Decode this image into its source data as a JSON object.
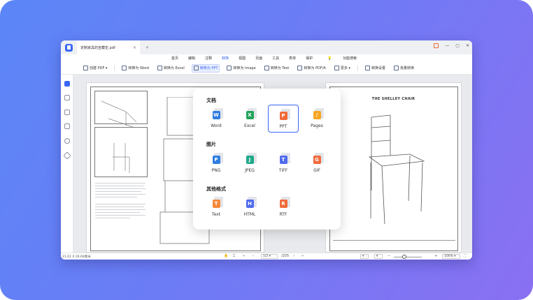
{
  "titlebar": {
    "doc_tab_title": "定制家具的宣藏史.pdf",
    "tab_close": "×",
    "tab_add": "+",
    "minimize": "—",
    "maximize": "▢",
    "close": "✕"
  },
  "menu": {
    "items": [
      "首页",
      "编辑",
      "注释",
      "转换",
      "视图",
      "页面",
      "工具",
      "表单",
      "保护"
    ],
    "active_index": 3,
    "search_placeholder": "功能搜索"
  },
  "toolbar": {
    "create_pdf": "创建 PDF",
    "to_word": "转换为 Word",
    "to_excel": "转换为 Excel",
    "to_ppt": "转换为 PPT",
    "to_image": "转换为 Image",
    "to_text": "转换为 Text",
    "to_pdfa": "转换为 PDF/A",
    "more": "更多",
    "convert_settings": "转换设置",
    "batch_convert": "批量转换"
  },
  "document": {
    "right_page_title": "THE SHELLEY CHAIR"
  },
  "popup": {
    "sections": [
      {
        "title": "文档",
        "items": [
          {
            "label": "Word",
            "letter": "W",
            "color": "#2f7de1"
          },
          {
            "label": "Excel",
            "letter": "X",
            "color": "#22a35a"
          },
          {
            "label": "PPT",
            "letter": "P",
            "color": "#f06a3a"
          },
          {
            "label": "Pages",
            "letter": "∕",
            "color": "#f5a623"
          }
        ]
      },
      {
        "title": "图片",
        "items": [
          {
            "label": "PNG",
            "letter": "P",
            "color": "#2f7de1"
          },
          {
            "label": "JPEG",
            "letter": "J",
            "color": "#20a88a"
          },
          {
            "label": "TIFF",
            "letter": "T",
            "color": "#4f6bee"
          },
          {
            "label": "GIF",
            "letter": "G",
            "color": "#f06a3a"
          }
        ]
      },
      {
        "title": "其他格式",
        "items": [
          {
            "label": "Text",
            "letter": "T",
            "color": "#f5883a"
          },
          {
            "label": "HTML",
            "letter": "H",
            "color": "#4f6bee"
          },
          {
            "label": "RTF",
            "letter": "R",
            "color": "#f06a3a"
          }
        ]
      }
    ],
    "selected": "PPT"
  },
  "statusbar": {
    "page_size": "21.01 X 29.69厘米",
    "current_page": "1/2",
    "total_pages": "/205",
    "zoom": "100%"
  },
  "colors": {
    "accent": "#3a66f5",
    "background_start": "#5b86f7",
    "background_end": "#8a70f2"
  }
}
